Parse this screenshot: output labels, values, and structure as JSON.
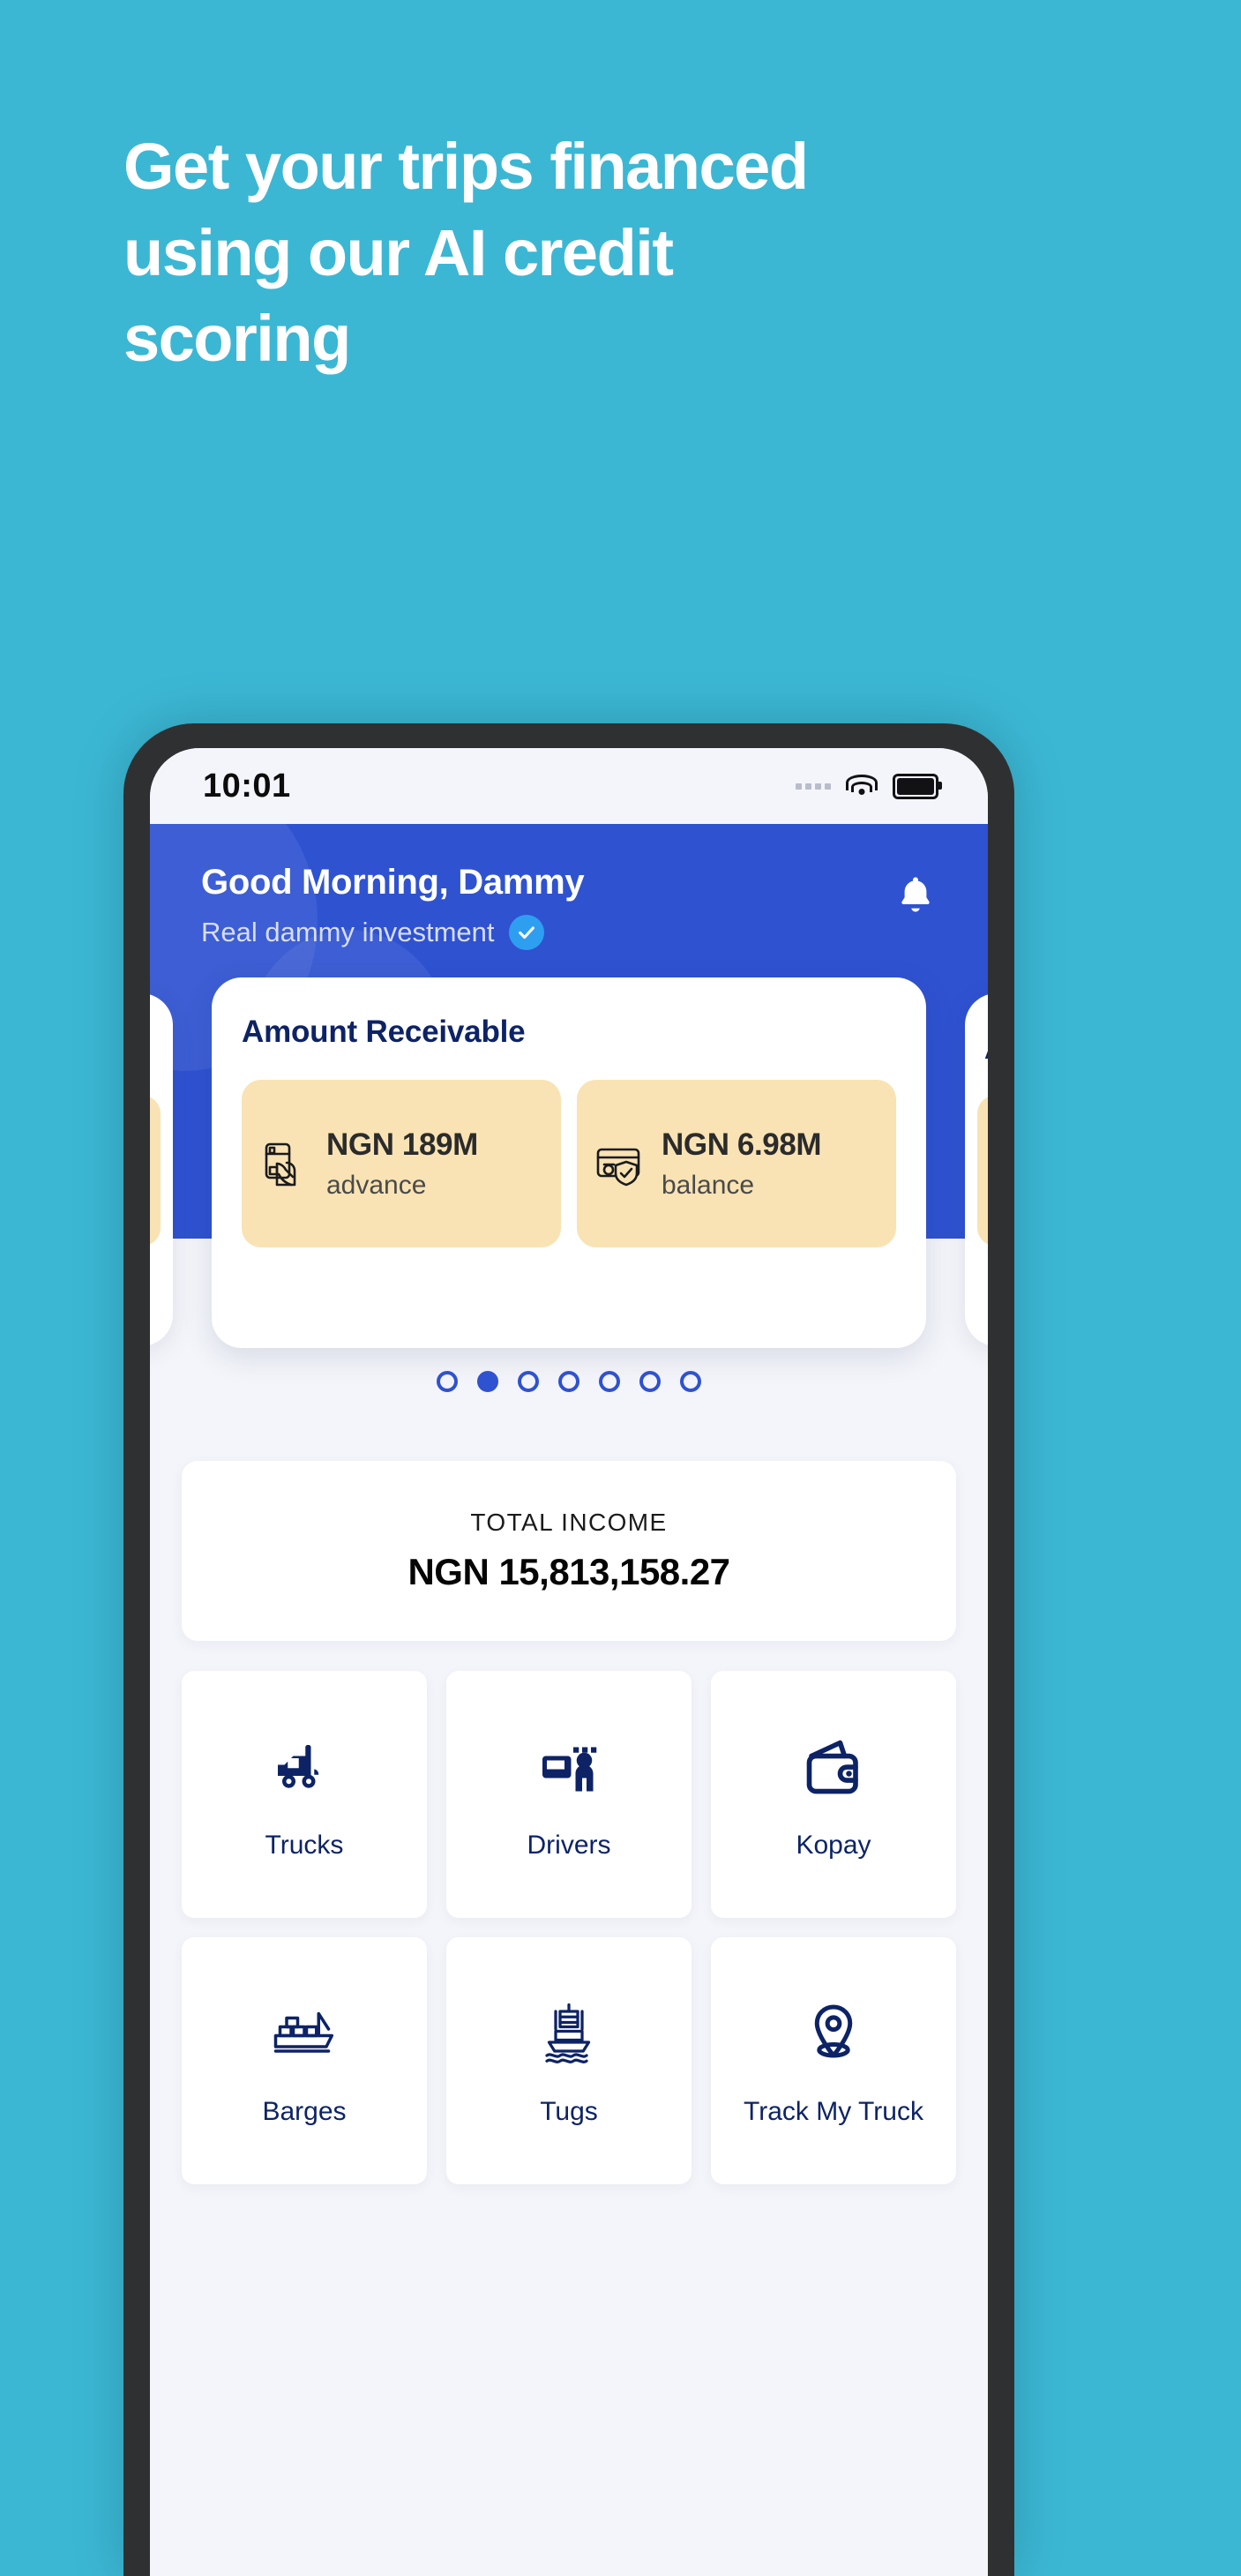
{
  "promo": {
    "headline_lines": [
      "Get your trips financed",
      "using our AI credit",
      "scoring"
    ],
    "background_color": "#3bb7d4",
    "text_color": "#ffffff"
  },
  "phone": {
    "status_bar": {
      "time": "10:01",
      "signal_icon": "signal-dots-icon",
      "wifi_icon": "wifi-icon",
      "battery_icon": "battery-full-icon"
    },
    "header": {
      "greeting": "Good Morning, Dammy",
      "company": "Real dammy investment",
      "verified_icon": "verified-check-icon",
      "notification_icon": "bell-icon",
      "background_color": "#2f52d1"
    },
    "carousel": {
      "card": {
        "title": "Amount Receivable",
        "tiles": [
          {
            "icon": "hand-holding-card-icon",
            "value": "NGN 189M",
            "label": "advance"
          },
          {
            "icon": "secure-card-icon",
            "value": "NGN 6.98M",
            "label": "balance"
          }
        ]
      },
      "side_card_right_partial_label": "A",
      "dot_count": 7,
      "active_dot_index": 1,
      "dot_color": "#2f52d1"
    },
    "total_income": {
      "label": "TOTAL INCOME",
      "value": "NGN 15,813,158.27"
    },
    "quick_actions": [
      {
        "label": "Trucks",
        "icon": "truck-icon"
      },
      {
        "label": "Drivers",
        "icon": "driver-icon"
      },
      {
        "label": "Kopay",
        "icon": "wallet-icon"
      },
      {
        "label": "Barges",
        "icon": "barge-ship-icon"
      },
      {
        "label": "Tugs",
        "icon": "tugboat-icon"
      },
      {
        "label": "Track My Truck",
        "icon": "map-pin-icon"
      }
    ],
    "accent_color": "#0d2366",
    "tile_color": "#f9e3b4"
  }
}
